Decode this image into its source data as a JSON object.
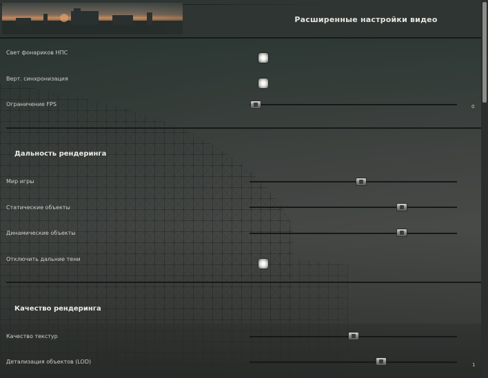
{
  "header": {
    "title": "Расширенные настройки видео"
  },
  "rows": {
    "npc_flashlights": {
      "label": "Свет фонариков НПС",
      "checked": true
    },
    "vsync": {
      "label": "Верт. синхронизация",
      "checked": true
    },
    "fps_limit": {
      "label": "Ограничение FPS",
      "value": "0",
      "level": 0.03
    }
  },
  "render_distance": {
    "title": "Дальность рендеринга",
    "world": {
      "label": "Мир игры",
      "level": 0.54
    },
    "static": {
      "label": "Статические объекты",
      "level": 0.73
    },
    "dynamic": {
      "label": "Динамические объекты",
      "level": 0.73
    },
    "far_shadows": {
      "label": "Отключить дальние тени",
      "checked": true
    }
  },
  "render_quality": {
    "title": "Качество рендеринга",
    "textures": {
      "label": "Качество текстур",
      "level": 0.5
    },
    "lod": {
      "label": "Детализация объектов (LOD)",
      "value": "1",
      "level": 0.63
    }
  },
  "colors": {
    "background": "#3e4441",
    "header": "#2f3533",
    "text": "#d8d8d2",
    "track": "#151817"
  }
}
